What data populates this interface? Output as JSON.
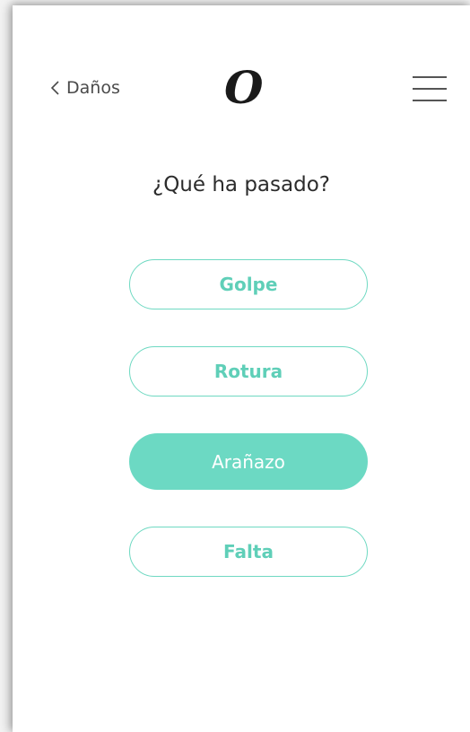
{
  "header": {
    "back_label": "Daños",
    "logo_text": "O"
  },
  "question": "¿Qué ha pasado?",
  "options": [
    {
      "label": "Golpe",
      "selected": false
    },
    {
      "label": "Rotura",
      "selected": false
    },
    {
      "label": "Arañazo",
      "selected": true
    },
    {
      "label": "Falta",
      "selected": false
    }
  ],
  "colors": {
    "accent": "#6cd9c3",
    "text": "#2c2c2c"
  },
  "icons": {
    "back": "chevron-left-icon",
    "menu": "hamburger-menu-icon"
  }
}
